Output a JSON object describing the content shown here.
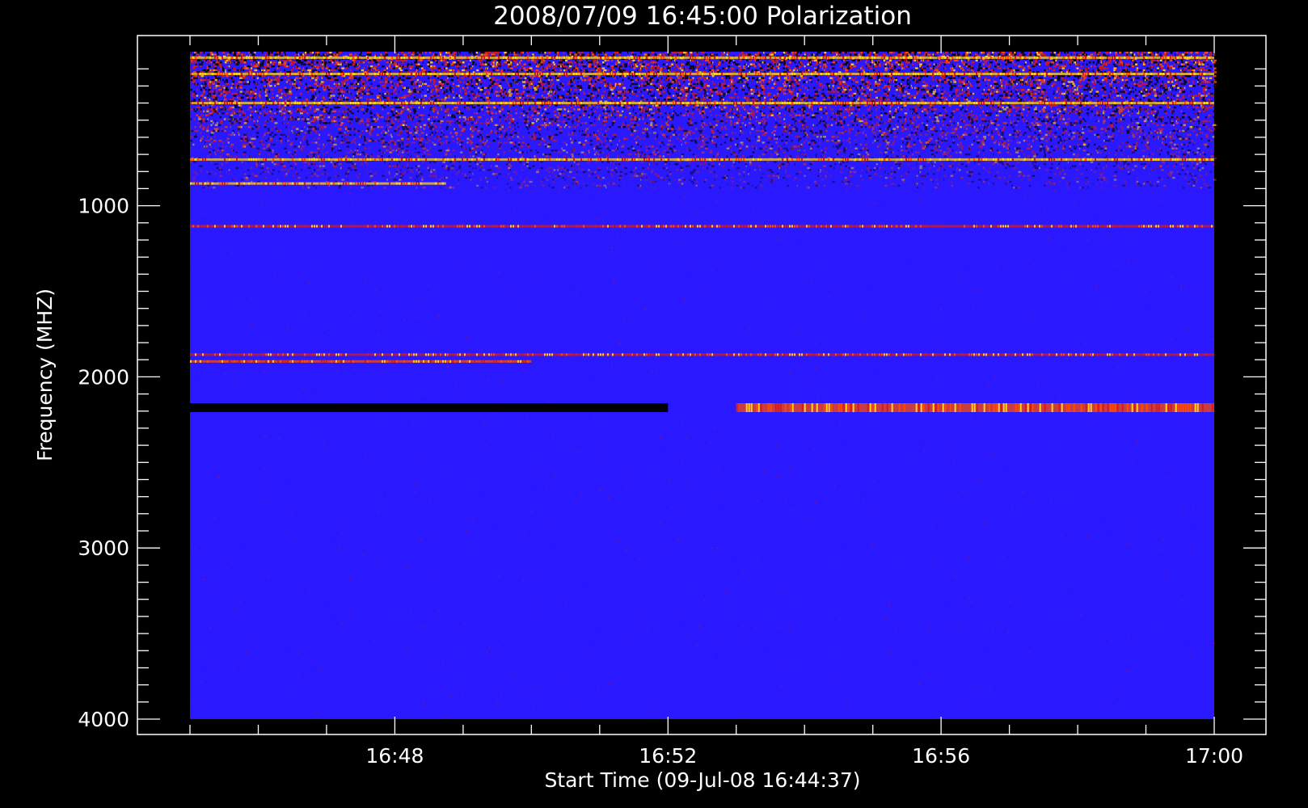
{
  "chart_data": {
    "type": "heatmap",
    "title": "2008/07/09 16:45:00 Polarization",
    "xlabel": "Start Time (09-Jul-08 16:44:37)",
    "ylabel": "Frequency (MHZ)",
    "x_range": [
      "16:45",
      "17:00"
    ],
    "y_range_mhz": [
      100,
      4000
    ],
    "y_axis_inverted": true,
    "x_ticks": [
      "16:48",
      "16:52",
      "16:56",
      "17:00"
    ],
    "y_ticks": [
      "1000",
      "2000",
      "3000",
      "4000"
    ],
    "background_value_color": "#2a19ff",
    "colors": {
      "background": "#000000",
      "foreground": "#ffffff",
      "low": "#000000",
      "base": "#2a19ff",
      "mid": "#d41b1b",
      "high": "#ff4a00",
      "peak": "#ffd21e"
    },
    "features": [
      {
        "kind": "interference-band",
        "freq_mhz_start": 100,
        "freq_mhz_end": 900,
        "note_level": "mixed"
      },
      {
        "kind": "line",
        "freq_mhz": 135,
        "time_start": "16:45",
        "time_end": "17:00",
        "level": "peak"
      },
      {
        "kind": "line",
        "freq_mhz": 230,
        "time_start": "16:45",
        "time_end": "17:00",
        "level": "peak"
      },
      {
        "kind": "line",
        "freq_mhz": 400,
        "time_start": "16:45",
        "time_end": "17:00",
        "level": "peak"
      },
      {
        "kind": "line",
        "freq_mhz": 730,
        "time_start": "16:45",
        "time_end": "17:00",
        "level": "peak"
      },
      {
        "kind": "line",
        "freq_mhz": 870,
        "time_start": "16:45",
        "time_end": "16:48:45",
        "level": "peak"
      },
      {
        "kind": "line",
        "freq_mhz": 1120,
        "time_start": "16:45",
        "time_end": "17:00",
        "level": "mid"
      },
      {
        "kind": "line",
        "freq_mhz": 1870,
        "time_start": "16:45",
        "time_end": "17:00",
        "level": "mid"
      },
      {
        "kind": "line",
        "freq_mhz": 1910,
        "time_start": "16:45",
        "time_end": "16:50",
        "level": "high"
      },
      {
        "kind": "line",
        "freq_mhz": 2180,
        "time_start": "16:45",
        "time_end": "16:52",
        "level": "low"
      },
      {
        "kind": "line",
        "freq_mhz": 2180,
        "time_start": "16:53",
        "time_end": "17:00",
        "level": "high"
      }
    ]
  }
}
